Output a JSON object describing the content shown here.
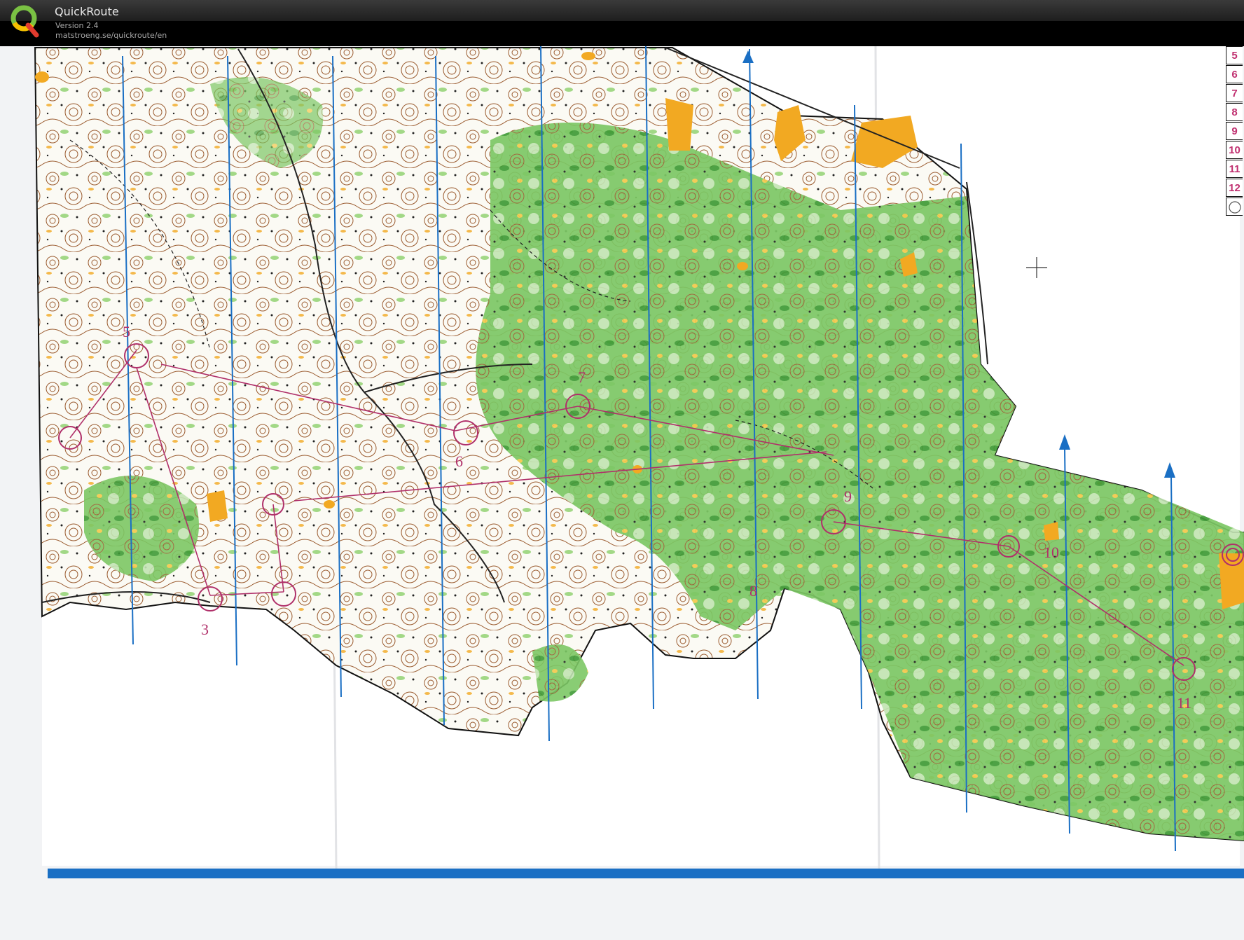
{
  "app": {
    "title": "QuickRoute",
    "version": "Version 2.4",
    "url": "matstroeng.se/quickroute/en"
  },
  "legend": {
    "numbers": [
      "5",
      "6",
      "7",
      "8",
      "9",
      "10",
      "11",
      "12"
    ]
  },
  "map": {
    "control_labels": [
      "3",
      "5",
      "6",
      "7",
      "8",
      "9",
      "10",
      "11"
    ]
  },
  "colors": {
    "forest_green": "#6cbf5a",
    "open_yellow": "#f2a922",
    "contour_brown": "#9a5a2e",
    "course_magenta": "#b0306a",
    "north_line_blue": "#1a6fc4"
  }
}
